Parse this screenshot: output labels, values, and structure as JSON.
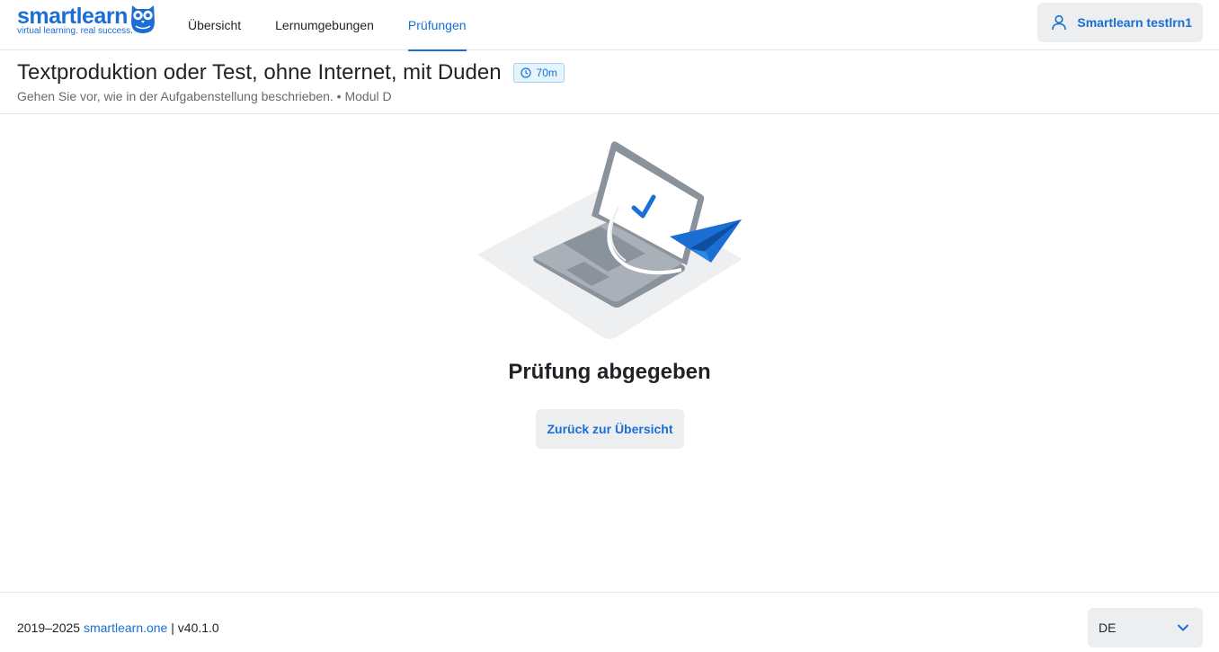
{
  "header": {
    "logo": {
      "word": "smartlearn",
      "tagline": "virtual learning. real success."
    },
    "nav": [
      {
        "label": "Übersicht",
        "active": false
      },
      {
        "label": "Lernumgebungen",
        "active": false
      },
      {
        "label": "Prüfungen",
        "active": true
      }
    ],
    "user": {
      "label": "Smartlearn testlrn1",
      "icon": "user-icon"
    }
  },
  "exam": {
    "title": "Textproduktion oder Test, ohne Internet, mit Duden",
    "duration": "70m",
    "duration_icon": "clock-icon",
    "subtitle": "Gehen Sie vor, wie in der Aufgabenstellung beschrieben. • Modul D"
  },
  "result": {
    "illustration": "laptop-paper-plane-checkmark",
    "title": "Prüfung abgegeben",
    "back_button": "Zurück zur Übersicht"
  },
  "footer": {
    "years": "2019–2025",
    "site_link": "smartlearn.one",
    "version": "| v40.1.0",
    "language": "DE",
    "language_icon": "chevron-down-icon"
  },
  "colors": {
    "accent": "#1a6ed4",
    "button_bg": "#eceef0",
    "badge_bg": "#e6f4fc",
    "badge_border": "#9fd3f0"
  }
}
